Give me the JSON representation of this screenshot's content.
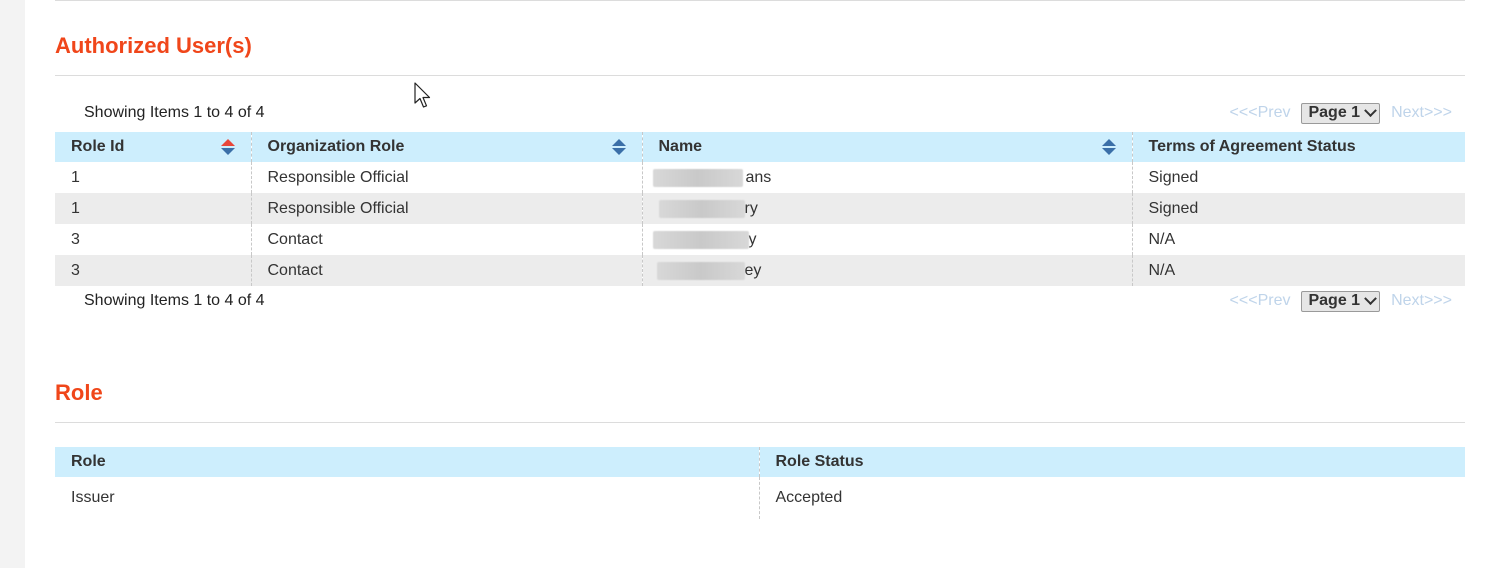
{
  "authorized_users": {
    "title": "Authorized User(s)",
    "showing_top": "Showing Items 1 to 4 of 4",
    "showing_bottom": "Showing Items 1 to 4 of 4",
    "pager": {
      "prev": "<<<Prev",
      "page": "Page 1",
      "next": "Next>>>"
    },
    "columns": [
      "Role Id",
      "Organization Role",
      "Name",
      "Terms of Agreement Status"
    ],
    "rows": [
      {
        "role_id": "1",
        "org_role": "Responsible Official",
        "name": "ans",
        "status": "Signed"
      },
      {
        "role_id": "1",
        "org_role": "Responsible Official",
        "name": "ry",
        "status": "Signed"
      },
      {
        "role_id": "3",
        "org_role": "Contact",
        "name": "y",
        "status": "N/A"
      },
      {
        "role_id": "3",
        "org_role": "Contact",
        "name": "ey",
        "status": "N/A"
      }
    ]
  },
  "role": {
    "title": "Role",
    "columns": [
      "Role",
      "Role Status"
    ],
    "rows": [
      {
        "role": "Issuer",
        "status": "Accepted"
      }
    ]
  },
  "colors": {
    "accent": "#f0461a",
    "header_bg": "#cdeefd",
    "row_alt": "#ececec",
    "sort_active": "#e8463a",
    "sort_icon": "#3a6fa8"
  },
  "icons": {
    "sort": "sort-arrows-icon",
    "cursor": "mouse-pointer-icon",
    "dropdown": "chevron-down-icon"
  }
}
